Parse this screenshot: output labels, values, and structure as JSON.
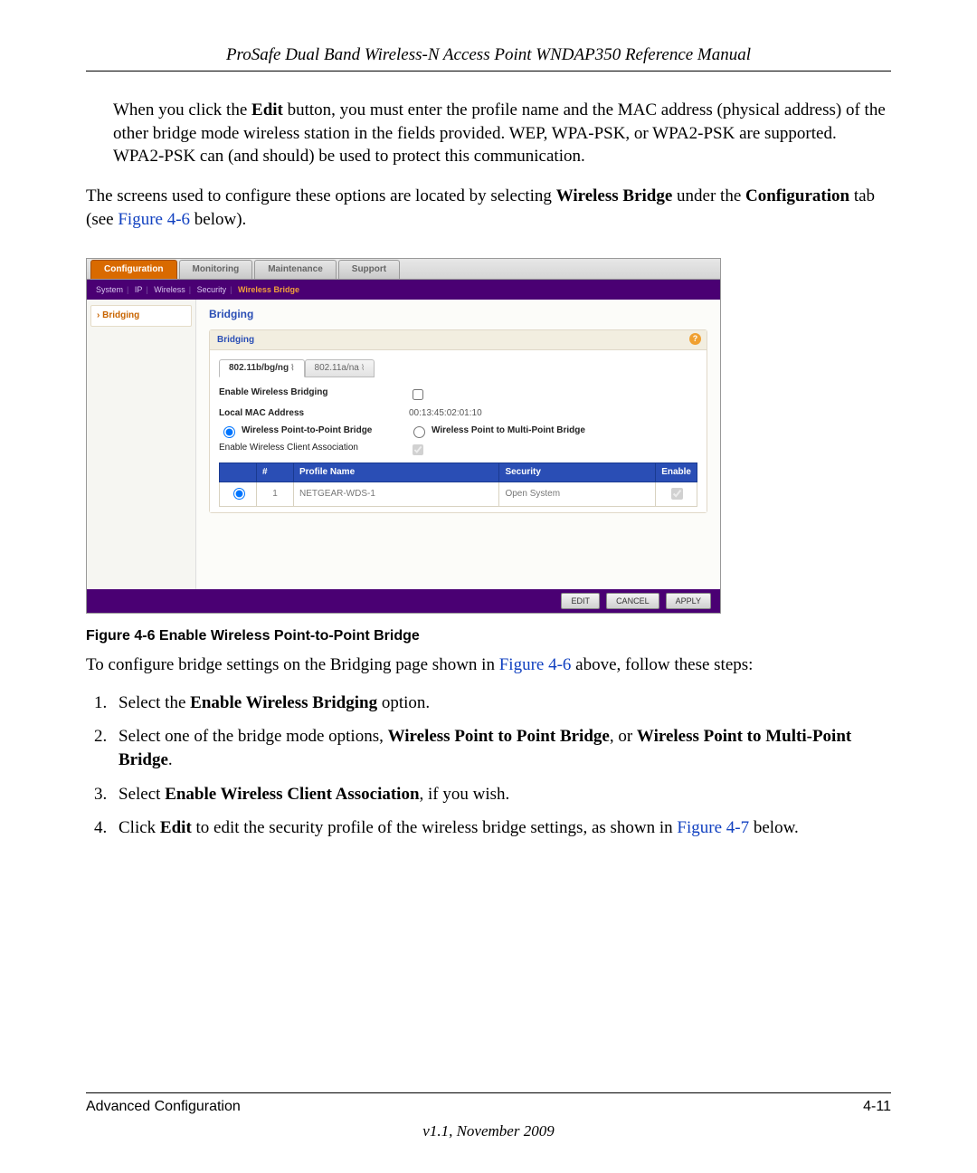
{
  "header": {
    "doc_title": "ProSafe Dual Band Wireless-N Access Point WNDAP350 Reference Manual"
  },
  "intro": {
    "para1_pre": "When you click the ",
    "para1_bold1": "Edit",
    "para1_post": " button, you must enter the profile name and the MAC address (physical address) of the other bridge mode wireless station in the fields provided. WEP, WPA-PSK, or WPA2-PSK are supported. WPA2-PSK can (and should) be used to protect this communication.",
    "para2_pre": "The screens used to configure these options are located by selecting ",
    "para2_bold1": "Wireless Bridge",
    "para2_mid": " under the ",
    "para2_bold2": "Configuration",
    "para2_post1": " tab (see ",
    "para2_link": "Figure 4-6",
    "para2_post2": " below)."
  },
  "ui": {
    "top_tabs": [
      "Configuration",
      "Monitoring",
      "Maintenance",
      "Support"
    ],
    "subnav": [
      "System",
      "IP",
      "Wireless",
      "Security",
      "Wireless Bridge"
    ],
    "side_item": "Bridging",
    "section_title": "Bridging",
    "panel_title": "Bridging",
    "band_tabs": {
      "tab1": "802.11b/bg/ng",
      "tab2": "802.11a/na"
    },
    "fields": {
      "enable_bridging_label": "Enable Wireless Bridging",
      "local_mac_label": "Local MAC Address",
      "local_mac_value": "00:13:45:02:01:10",
      "radio_p2p": "Wireless Point-to-Point Bridge",
      "radio_multi": "Wireless Point to Multi-Point Bridge",
      "enable_client_assoc": "Enable Wireless Client Association"
    },
    "table": {
      "headers": {
        "radio": "",
        "num": "#",
        "profile": "Profile Name",
        "security": "Security",
        "enable": "Enable"
      },
      "row": {
        "num": "1",
        "profile": "NETGEAR-WDS-1",
        "security": "Open System"
      }
    },
    "buttons": {
      "edit": "EDIT",
      "cancel": "CANCEL",
      "apply": "APPLY"
    },
    "help": "?"
  },
  "figure_caption": "Figure 4-6  Enable Wireless Point-to-Point Bridge",
  "after_figure": {
    "pre": "To configure bridge settings on the Bridging page shown in ",
    "link": "Figure 4-6",
    "post": " above, follow these steps:"
  },
  "steps": {
    "s1_pre": "Select the ",
    "s1_bold": "Enable Wireless Bridging",
    "s1_post": " option.",
    "s2_pre": "Select one of the bridge mode options, ",
    "s2_bold1": "Wireless Point to Point Bridge",
    "s2_mid": ", or ",
    "s2_bold2": "Wireless Point to Multi-Point Bridge",
    "s2_post": ".",
    "s3_pre": "Select ",
    "s3_bold": "Enable Wireless Client Association",
    "s3_post": ", if you wish.",
    "s4_pre": "Click ",
    "s4_bold": "Edit",
    "s4_mid": " to edit the security profile of the wireless bridge settings, as shown in ",
    "s4_link": "Figure 4-7",
    "s4_post": " below."
  },
  "footer": {
    "left": "Advanced Configuration",
    "right": "4-11",
    "version": "v1.1, November 2009"
  }
}
